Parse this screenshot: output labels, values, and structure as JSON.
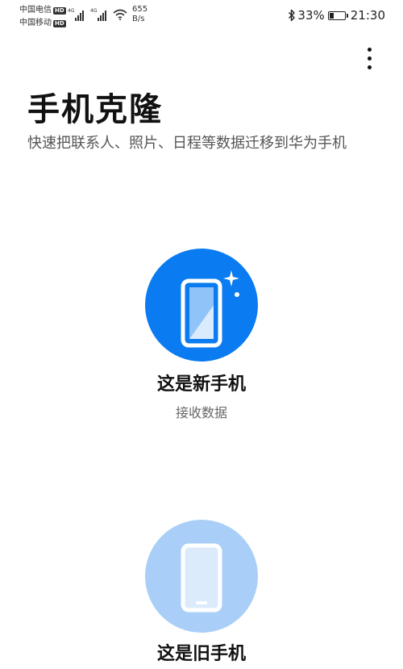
{
  "status_bar": {
    "carrier1": "中国电信",
    "carrier2": "中国移动",
    "hd_label": "HD",
    "network_type": "4G",
    "net_speed_value": "655",
    "net_speed_unit": "B/s",
    "battery_percent": "33%",
    "battery_level": 0.33,
    "time": "21:30"
  },
  "header": {
    "title": "手机克隆",
    "subtitle": "快速把联系人、照片、日程等数据迁移到华为手机"
  },
  "options": {
    "new_phone": {
      "title": "这是新手机",
      "subtitle": "接收数据",
      "circle_color": "#0A7BF0",
      "icon": "new-phone-icon"
    },
    "old_phone": {
      "title": "这是旧手机",
      "circle_color": "#A9CFF8",
      "icon": "old-phone-icon"
    }
  },
  "colors": {
    "accent": "#0A7BF0",
    "accent_light": "#A9CFF8"
  }
}
